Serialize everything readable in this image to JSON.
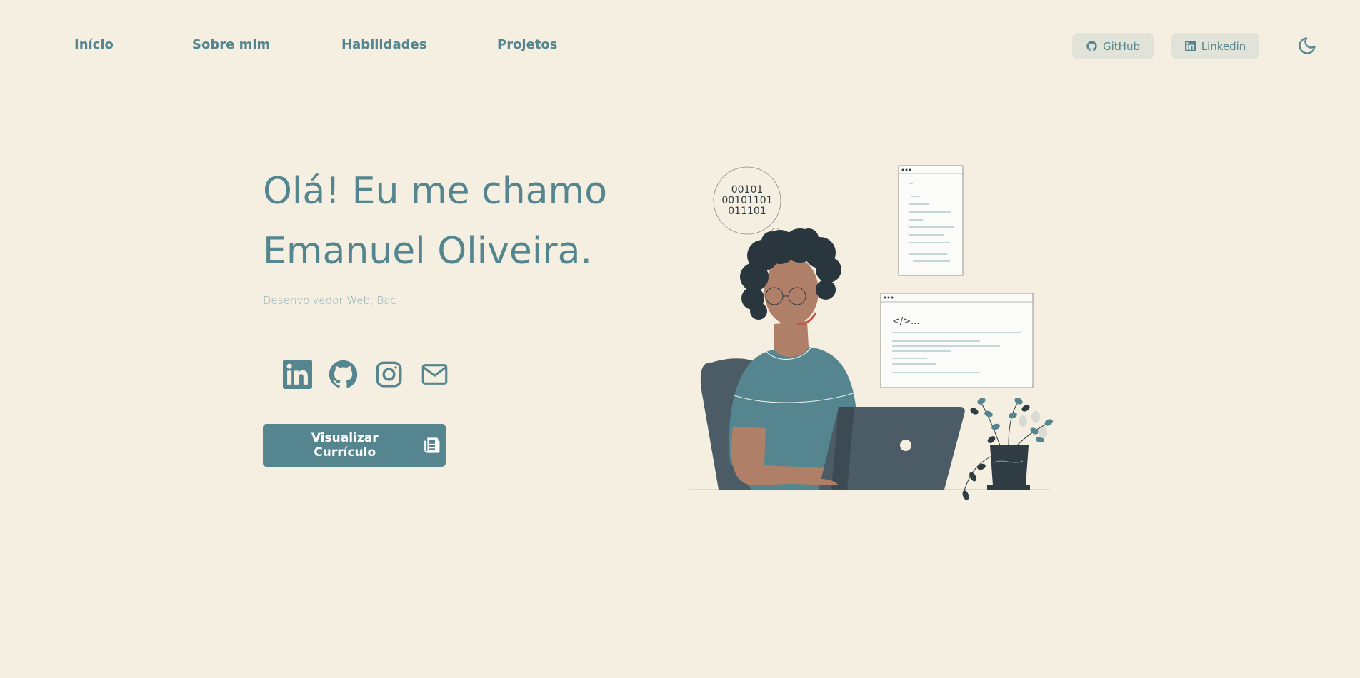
{
  "nav": {
    "links": [
      {
        "label": "Início"
      },
      {
        "label": "Sobre mim"
      },
      {
        "label": "Habilidades"
      },
      {
        "label": "Projetos"
      }
    ],
    "github_label": "GitHub",
    "linkedin_label": "Linkedin",
    "theme_icon": "moon-icon"
  },
  "hero": {
    "title_line1": "Olá! Eu me chamo",
    "title_line2": "Emanuel Oliveira.",
    "subtitle": "Desenvolvedor Web, Bac",
    "socials": [
      {
        "icon": "linkedin-icon"
      },
      {
        "icon": "github-icon"
      },
      {
        "icon": "instagram-icon"
      },
      {
        "icon": "mail-icon"
      }
    ],
    "cv_button_label": "Visualizar Currículo"
  },
  "illustration": {
    "bubble_lines": [
      "00101",
      "00101101",
      "011101"
    ],
    "code_tag": "</>..."
  },
  "colors": {
    "background": "#f5efe1",
    "accent": "#55868f",
    "pill_bg": "#e1e3d8",
    "dark": "#2f3c44"
  }
}
